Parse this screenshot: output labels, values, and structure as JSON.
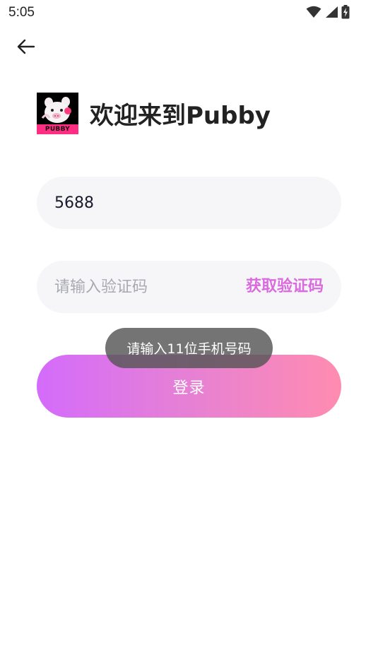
{
  "status_bar": {
    "time": "5:05",
    "icons": [
      "wifi-icon",
      "cell-signal-icon",
      "battery-charging-icon"
    ]
  },
  "nav": {
    "back_icon": "arrow-left-icon"
  },
  "header": {
    "logo_text": "PUBBY",
    "title": "欢迎来到Pubby"
  },
  "form": {
    "phone_value": "5688",
    "code_placeholder": "请输入验证码",
    "get_code_label": "获取验证码",
    "login_label": "登录"
  },
  "toast": {
    "message": "请输入11位手机号码"
  },
  "colors": {
    "accent": "#d96bdf",
    "button_gradient_start": "#d46bfb",
    "button_gradient_end": "#ff8cb0",
    "field_bg": "#f6f6f9",
    "logo_band": "#ff2e83"
  }
}
